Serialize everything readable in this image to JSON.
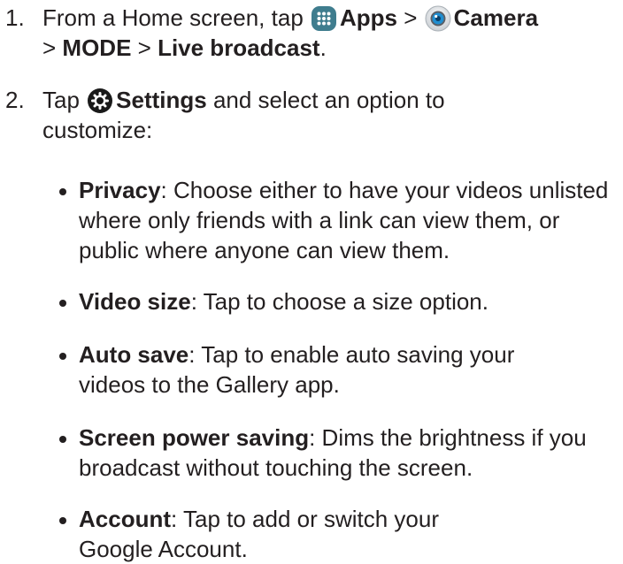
{
  "steps": [
    {
      "number": "1.",
      "t1": "From a Home screen, tap ",
      "b1": "Apps",
      "t2": " > ",
      "b2": "Camera",
      "t3": "> ",
      "b3": "MODE",
      "t4": " > ",
      "b4": "Live broadcast",
      "t5": ".",
      "icon1": "apps-grid-icon",
      "icon2": "camera-icon"
    },
    {
      "number": "2.",
      "t1": "Tap ",
      "b1": "Settings",
      "t2": " and select an option to customize:",
      "icon1": "settings-gear-icon"
    }
  ],
  "bullets": [
    {
      "term": "Privacy",
      "text": ": Choose either to have your videos unlisted where only friends with a link can view them, or public where anyone can view them."
    },
    {
      "term": "Video size",
      "text": ": Tap to choose a size option."
    },
    {
      "term": "Auto save",
      "text": ": Tap to enable auto saving your videos to the Gallery app."
    },
    {
      "term": "Screen power saving",
      "text": ": Dims the brightness if you broadcast without touching the screen."
    },
    {
      "term": "Account",
      "text": ": Tap to add or switch your Google Account."
    }
  ],
  "colors": {
    "text": "#231f20",
    "apps_icon": "#3f7d8e",
    "settings_icon": "#1a1a1a",
    "camera_lens": "#1f8ed1"
  }
}
